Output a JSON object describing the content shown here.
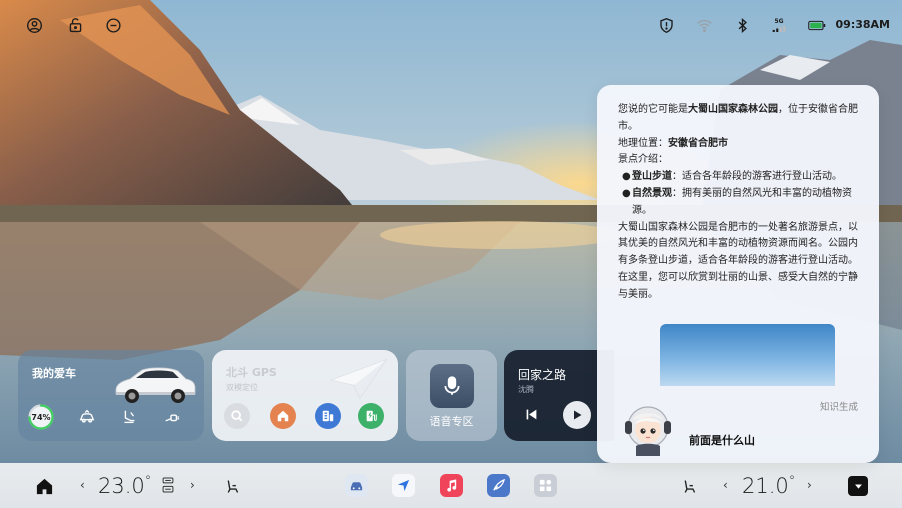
{
  "status_bar": {
    "time": "09:38AM",
    "network_label": "5G",
    "left_icons": [
      "person-circle-icon",
      "lock-icon",
      "message-icon"
    ],
    "right_icons": [
      "shield-icon",
      "wifi-icon",
      "bluetooth-icon",
      "signal-5g-icon",
      "battery-icon"
    ],
    "battery_color": "#2bb24c"
  },
  "widgets": {
    "car": {
      "title": "我的爱车",
      "battery_percent": "74%",
      "battery_level": 0.74,
      "accent": "#3ecf5e"
    },
    "gps": {
      "title": "北斗 GPS",
      "subtitle": "双模定位"
    },
    "voice": {
      "label": "语音专区"
    },
    "music": {
      "title": "回家之路",
      "artist": "沈腾"
    }
  },
  "assistant_panel": {
    "intro_prefix": "您说的它可能是",
    "intro_bold": "大蜀山国家森林公园",
    "intro_suffix": "，位于安徽省合肥市。",
    "location_label": "地理位置：",
    "location_value": "安徽省合肥市",
    "features_label": "景点介绍：",
    "bullets": [
      {
        "bold": "登山步道",
        "text": "：适合各年龄段的游客进行登山活动。"
      },
      {
        "bold": "自然景观",
        "text": "：拥有美丽的自然风光和丰富的动植物资源。"
      }
    ],
    "summary": "大蜀山国家森林公园是合肥市的一处著名旅游景点，以其优美的自然风光和丰富的动植物资源而闻名。公园内有多条登山步道，适合各年龄段的游客进行登山活动。在这里，您可以欣赏到壮丽的山景、感受大自然的宁静与美丽。",
    "knowledge_label": "知识生成",
    "question": "前面是什么山"
  },
  "dock": {
    "left_temp": "23.0",
    "right_temp": "21.0",
    "degree_symbol": "°",
    "chevron_left": "‹",
    "chevron_right": "›",
    "apps": [
      "car-app-icon",
      "navigation-app-icon",
      "music-app-icon",
      "feather-app-icon",
      "grid-app-icon"
    ]
  }
}
